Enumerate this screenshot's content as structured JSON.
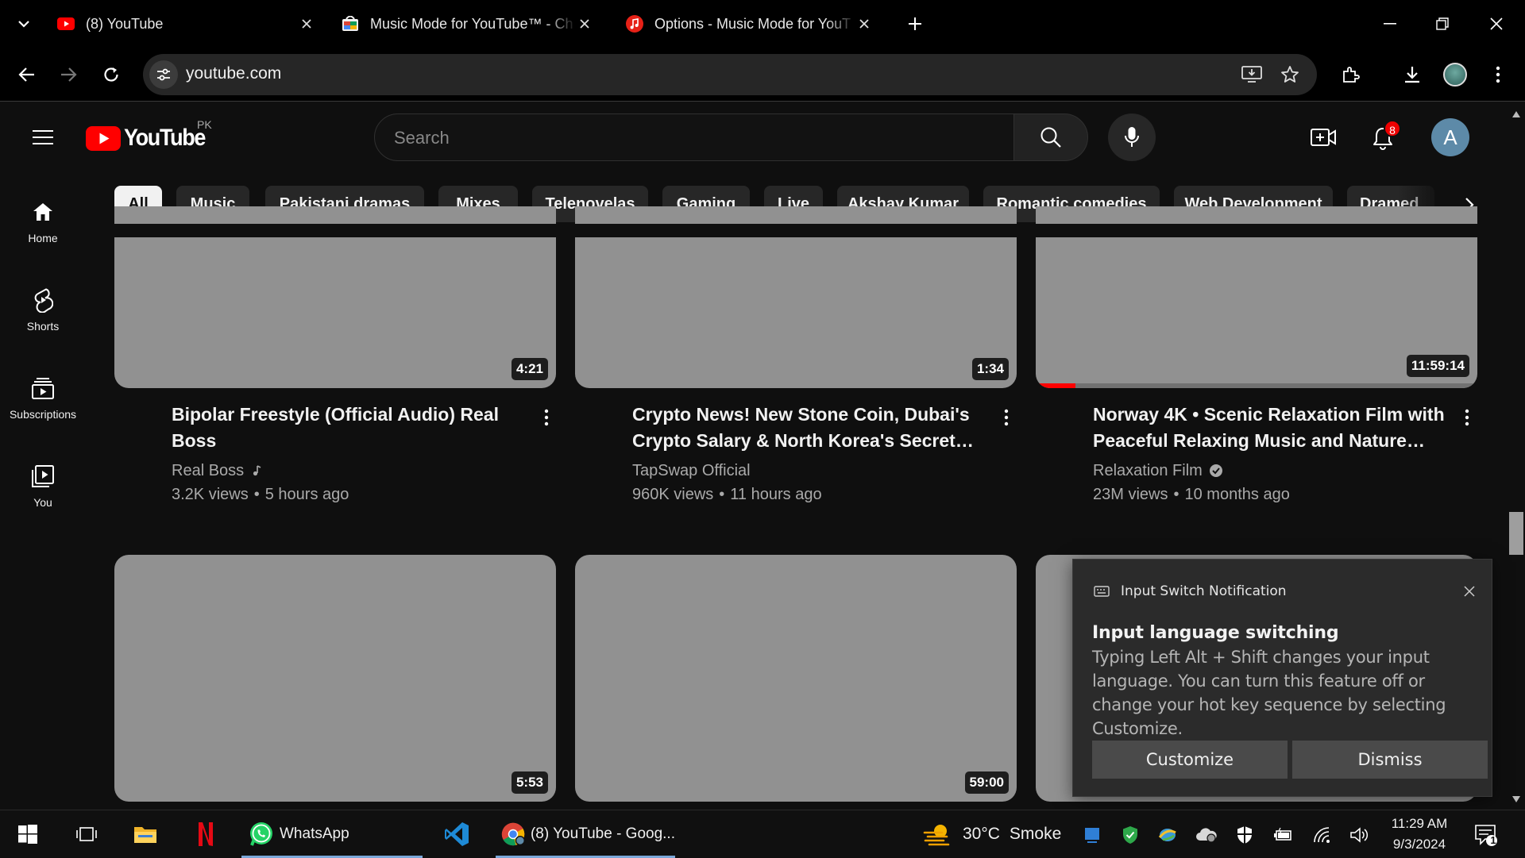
{
  "browser": {
    "tabs": [
      {
        "title": "(8) YouTube"
      },
      {
        "title": "Music Mode for YouTube™ - Ch"
      },
      {
        "title": "Options - Music Mode for YouT"
      }
    ],
    "url": "youtube.com"
  },
  "youtube": {
    "logo_text": "YouTube",
    "country_code": "PK",
    "search_placeholder": "Search",
    "notification_count": "8",
    "account_initial": "A",
    "guide": [
      {
        "label": "Home",
        "icon": "home-icon"
      },
      {
        "label": "Shorts",
        "icon": "shorts-icon"
      },
      {
        "label": "Subscriptions",
        "icon": "subscriptions-icon"
      },
      {
        "label": "You",
        "icon": "you-icon"
      }
    ],
    "chips": [
      "All",
      "Music",
      "Pakistani dramas",
      "Mixes",
      "Telenovelas",
      "Gaming",
      "Live",
      "Akshay Kumar",
      "Romantic comedies",
      "Web Development",
      "Dramed"
    ],
    "videos": [
      {
        "title": "Bipolar Freestyle (Official Audio) Real Boss",
        "channel": "Real Boss",
        "channel_badge": "music-note-icon",
        "views": "3.2K views",
        "age": "5 hours ago",
        "duration": "4:21"
      },
      {
        "title": "Crypto News! New Stone Coin, Dubai's Crypto Salary & North Korea's Secret…",
        "channel": "TapSwap Official",
        "views": "960K views",
        "age": "11 hours ago",
        "duration": "1:34"
      },
      {
        "title": "Norway 4K • Scenic Relaxation Film with Peaceful Relaxing Music and Nature…",
        "channel": "Relaxation Film",
        "channel_badge": "verified-icon",
        "views": "23M views",
        "age": "10 months ago",
        "duration": "11:59:14",
        "watched_fraction": 0.09
      },
      {
        "duration": "5:53"
      },
      {
        "duration": "59:00"
      }
    ]
  },
  "toast": {
    "app_name": "Input Switch Notification",
    "heading": "Input language switching",
    "body": "Typing Left Alt + Shift changes your input language. You can turn this feature off or change your hot key sequence by selecting Customize.",
    "customize_label": "Customize",
    "dismiss_label": "Dismiss"
  },
  "taskbar": {
    "whatsapp_label": "WhatsApp",
    "chrome_label": "(8) YouTube - Goog...",
    "weather_temp": "30°C",
    "weather_desc": "Smoke",
    "time": "11:29 AM",
    "date": "9/3/2024",
    "action_center_count": "1"
  },
  "colors": {
    "youtube_red": "#ff0000",
    "page_bg": "#0f0f0f",
    "chip_bg": "#272727",
    "thumbnail_placeholder": "#919191"
  }
}
